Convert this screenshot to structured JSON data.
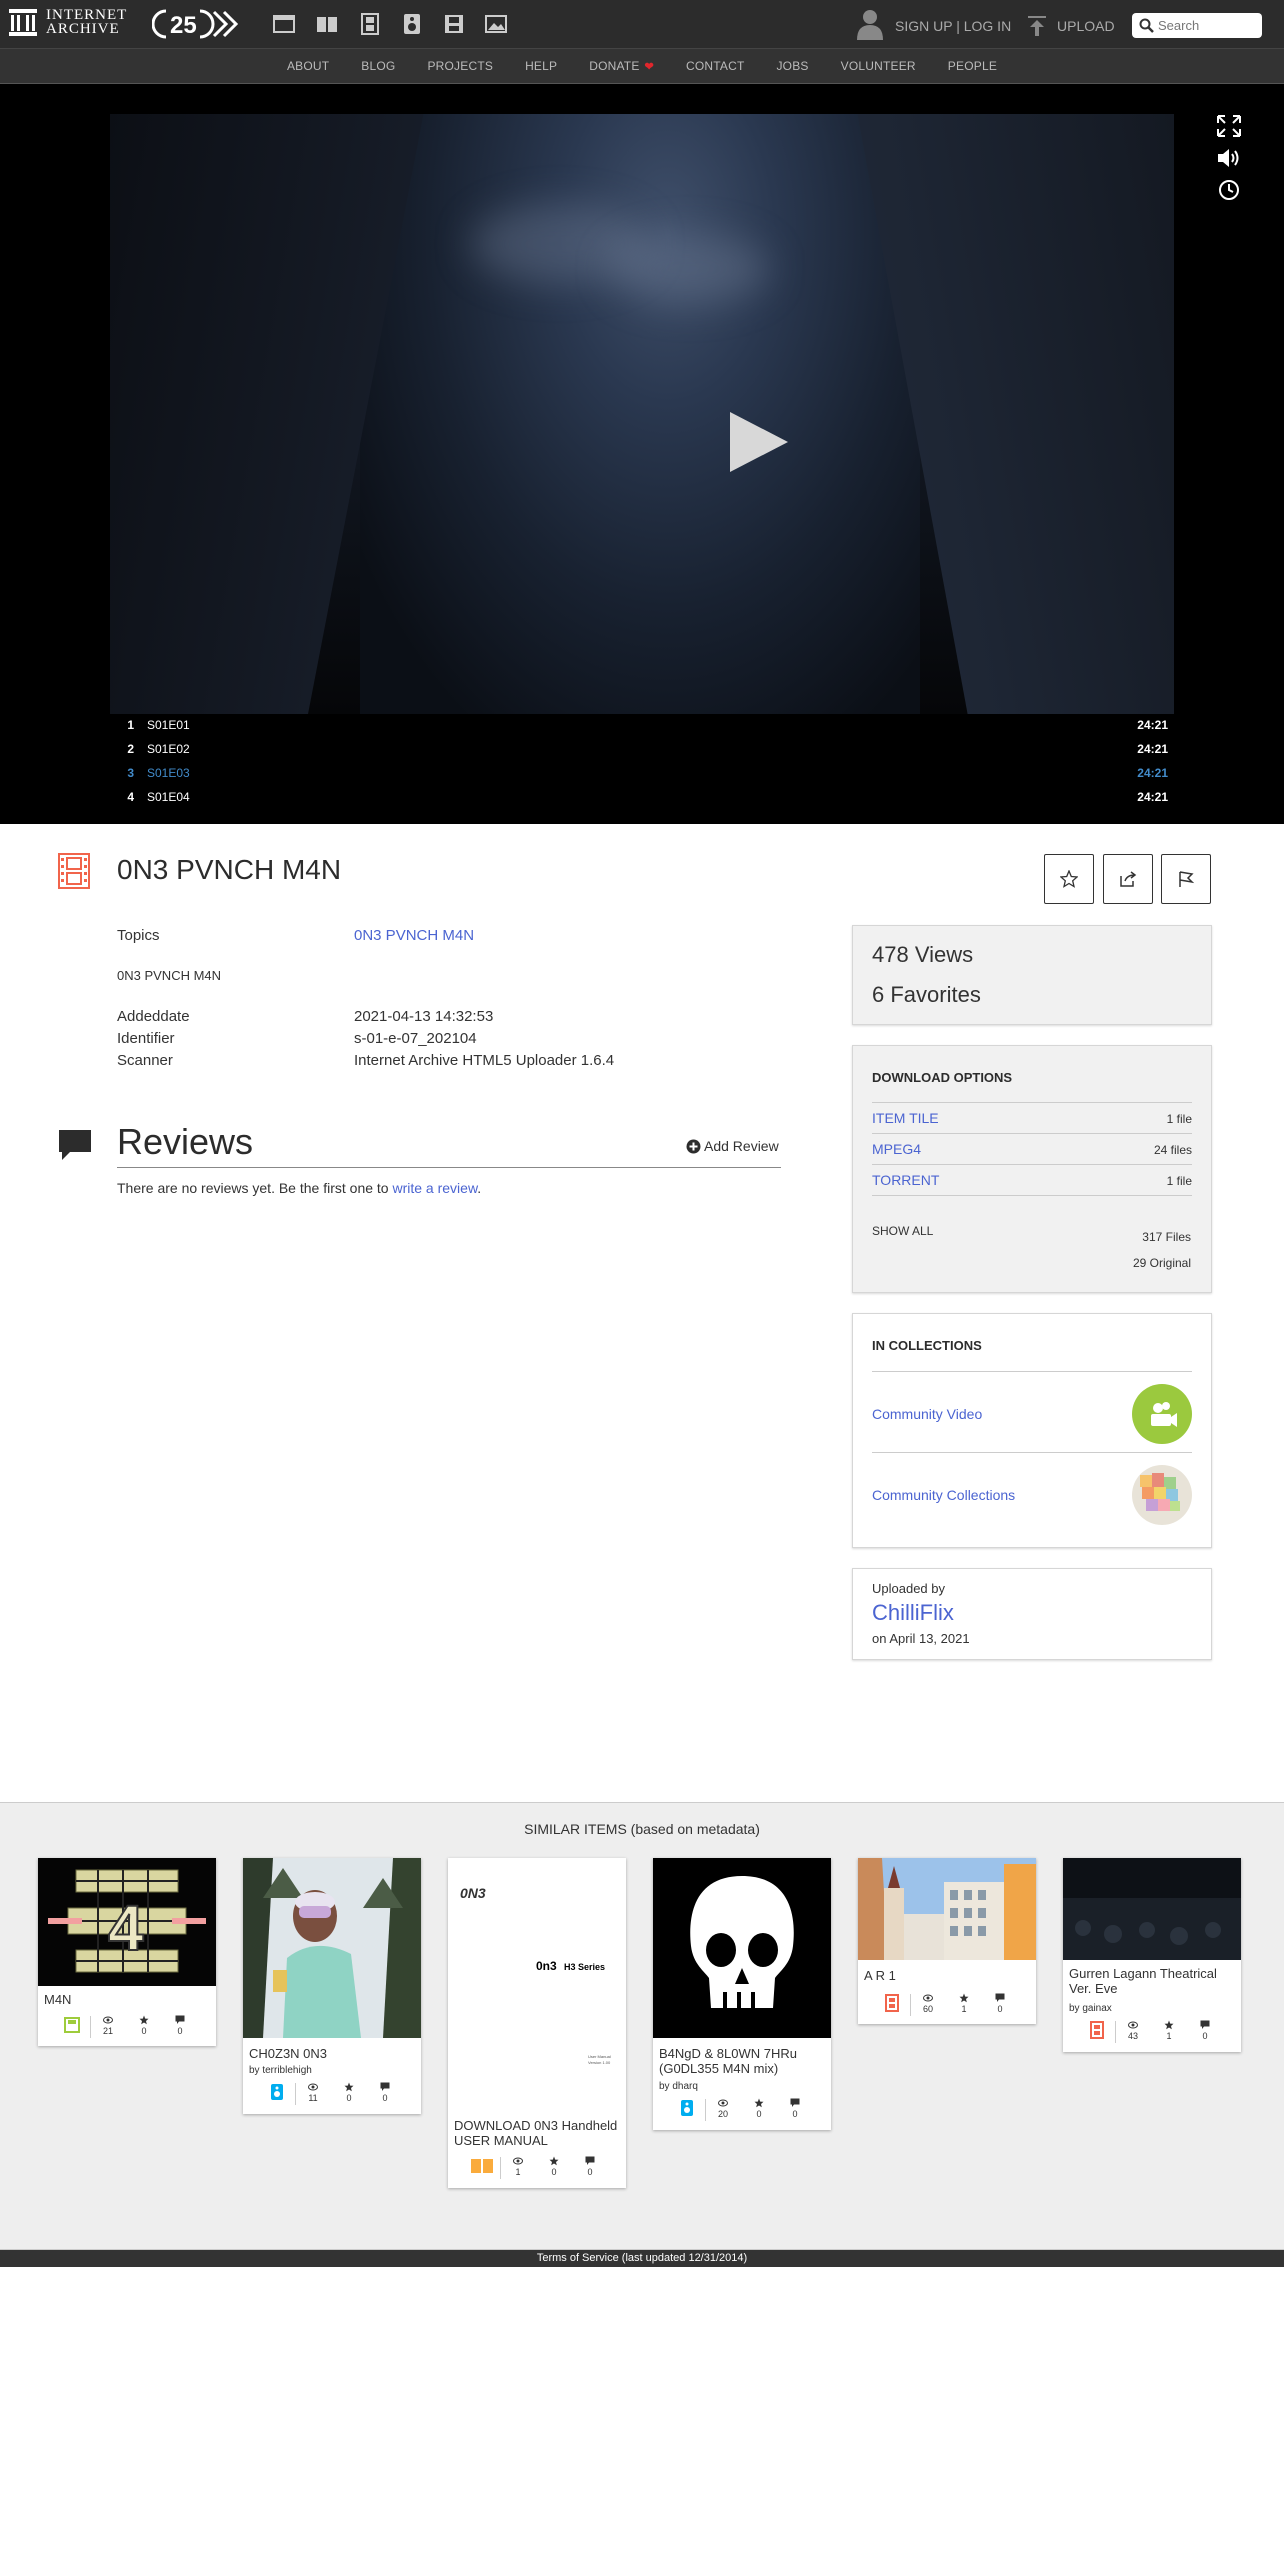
{
  "header": {
    "logo_text": "Internet Archive",
    "anniversary_badge": "25",
    "media_icons": [
      "web-icon",
      "texts-icon",
      "video-icon",
      "audio-icon",
      "software-icon",
      "images-icon"
    ],
    "signup_login": "SIGN UP | LOG IN",
    "upload": "UPLOAD",
    "search_placeholder": "Search"
  },
  "nav": {
    "items": [
      "ABOUT",
      "BLOG",
      "PROJECTS",
      "HELP",
      "DONATE",
      "CONTACT",
      "JOBS",
      "VOLUNTEER",
      "PEOPLE"
    ],
    "donate_heart": "❤"
  },
  "player": {
    "playlist": [
      {
        "num": "1",
        "title": "S01E01",
        "duration": "24:21",
        "active": false
      },
      {
        "num": "2",
        "title": "S01E02",
        "duration": "24:21",
        "active": false
      },
      {
        "num": "3",
        "title": "S01E03",
        "duration": "24:21",
        "active": true
      },
      {
        "num": "4",
        "title": "S01E04",
        "duration": "24:21",
        "active": false
      }
    ]
  },
  "item": {
    "title": "0N3 PVNCH M4N",
    "metadata": {
      "topics_label": "Topics",
      "topics_value": "0N3 PVNCH M4N",
      "description": "0N3 PVNCH M4N",
      "addeddate_label": "Addeddate",
      "addeddate_value": "2021-04-13 14:32:53",
      "identifier_label": "Identifier",
      "identifier_value": "s-01-e-07_202104",
      "scanner_label": "Scanner",
      "scanner_value": "Internet Archive HTML5 Uploader 1.6.4"
    }
  },
  "reviews": {
    "title": "Reviews",
    "add_review": "Add Review",
    "empty_text": "There are no reviews yet. Be the first one to ",
    "write_link": "write a review",
    "empty_end": "."
  },
  "stats": {
    "views": "478 Views",
    "favorites": "6 Favorites"
  },
  "downloads": {
    "heading": "DOWNLOAD OPTIONS",
    "rows": [
      {
        "label": "ITEM TILE",
        "count": "1 file"
      },
      {
        "label": "MPEG4",
        "count": "24 files"
      },
      {
        "label": "TORRENT",
        "count": "1 file"
      }
    ],
    "show_all": "SHOW ALL",
    "total_files": "317 Files",
    "original": "29 Original"
  },
  "collections": {
    "heading": "IN COLLECTIONS",
    "items": [
      {
        "label": "Community Video",
        "color": "#9bc93e"
      },
      {
        "label": "Community Collections",
        "color": "#f0a860"
      }
    ]
  },
  "uploader": {
    "label": "Uploaded by",
    "name": "ChilliFlix",
    "date": "on April 13, 2021"
  },
  "similar": {
    "title": "SIMILAR ITEMS (based on metadata)",
    "items": [
      {
        "title": "M4N",
        "by": "",
        "views": "21",
        "favs": "0",
        "reviews": "0",
        "mediatype": "software-icon",
        "media_color": "#9ecc3b"
      },
      {
        "title": "CH0Z3N 0N3",
        "by": "by terriblehigh",
        "views": "11",
        "favs": "0",
        "reviews": "0",
        "mediatype": "audio-icon",
        "media_color": "#00adef"
      },
      {
        "title": "DOWNLOAD 0N3 Handheld USER MANUAL",
        "by": "",
        "views": "1",
        "favs": "0",
        "reviews": "0",
        "mediatype": "texts-icon",
        "media_color": "#faab3c"
      },
      {
        "title": "B4NgD & 8L0WN 7HRu (G0DL355 M4N mix)",
        "by": "by dharq",
        "views": "20",
        "favs": "0",
        "reviews": "0",
        "mediatype": "audio-icon",
        "media_color": "#00adef"
      },
      {
        "title": "A R 1",
        "by": "",
        "views": "60",
        "favs": "1",
        "reviews": "0",
        "mediatype": "video-icon",
        "media_color": "#f1644b"
      },
      {
        "title": "Gurren Lagann Theatrical Ver. Eve",
        "by": "by gainax",
        "views": "43",
        "favs": "1",
        "reviews": "0",
        "mediatype": "video-icon",
        "media_color": "#f1644b"
      }
    ],
    "manual_cover": {
      "brand": "0N3",
      "series": "0n3",
      "series_suffix": "H3 Series",
      "footnote1": "User Manual",
      "footnote2": "Version 1.00"
    },
    "poster_letter": "4"
  },
  "footer": {
    "text": "Terms of Service (last updated 12/31/2014)"
  },
  "colors": {
    "link": "#4b64d1",
    "video_accent": "#f1644b",
    "playlist_active": "#428bca"
  }
}
